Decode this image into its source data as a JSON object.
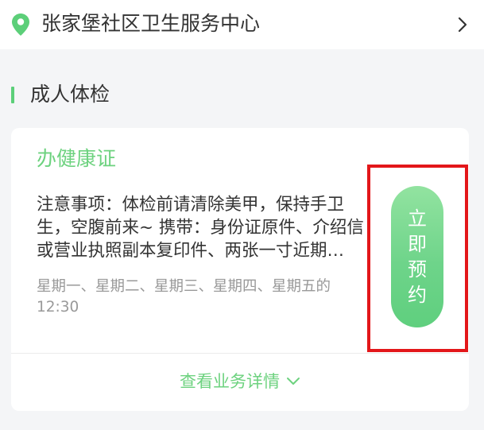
{
  "location": {
    "name": "张家堡社区卫生服务中心",
    "icon": "location-pin-icon",
    "chevron_icon": "chevron-right-icon"
  },
  "section": {
    "title": "成人体检"
  },
  "card": {
    "title": "办健康证",
    "notes": "注意事项：体检前请清除美甲，保持手卫生，空腹前来~ 携带：身份证原件、介绍信或营业执照副本复印件、两张一寸近期…",
    "hours_line1": "星期一、星期二、星期三、星期四、星期五的",
    "hours_line2": "12:30",
    "book_button": {
      "chars": [
        "立",
        "即",
        "预",
        "约"
      ]
    },
    "details_link": {
      "label": "查看业务详情",
      "icon": "chevron-down-icon"
    }
  },
  "colors": {
    "accent_green": "#6dd27f",
    "section_bar": "#5ccf79",
    "highlight_red": "#e3171a",
    "background": "#f4f5f7"
  }
}
